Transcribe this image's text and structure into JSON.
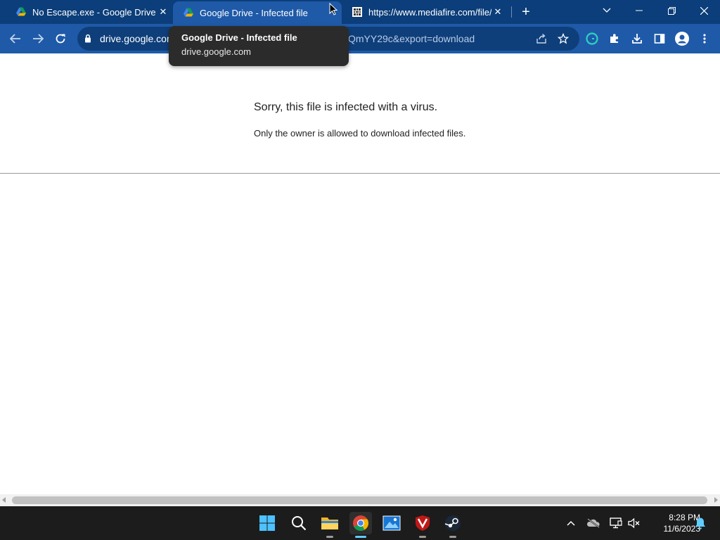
{
  "tabs": [
    {
      "title": "No Escape.exe - Google Drive",
      "favicon": "google-drive-icon",
      "active": false
    },
    {
      "title": "Google Drive - Infected file",
      "favicon": "google-drive-icon",
      "active": true
    },
    {
      "title": "https://www.mediafire.com/file/b",
      "favicon": "mediafire-icon",
      "active": false
    }
  ],
  "address_bar": {
    "url_left": "drive.google.com",
    "url_right": "QmYY29c&export=download"
  },
  "tooltip": {
    "title": "Google Drive - Infected file",
    "subtitle": "drive.google.com"
  },
  "page": {
    "heading": "Sorry, this file is infected with a virus.",
    "subtext": "Only the owner is allowed to download infected files."
  },
  "taskbar": {
    "apps": [
      "start-icon",
      "search-icon",
      "file-explorer-icon",
      "chrome-icon",
      "photos-icon",
      "mcafee-icon",
      "steam-icon"
    ],
    "time": "8:28 PM",
    "date": "11/6/2023"
  },
  "colors": {
    "tabstrip": "#0b3e7a",
    "toolbar": "#1f5aa8",
    "omnibox": "#0e3f7b",
    "taskbar": "#1c1c1c"
  }
}
